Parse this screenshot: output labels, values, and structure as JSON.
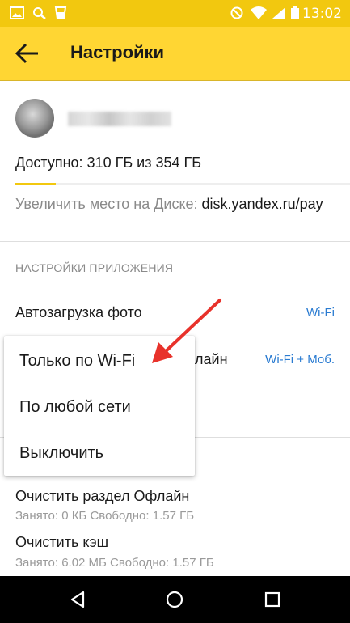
{
  "statusbar": {
    "time": "13:02",
    "icons": [
      "image-icon",
      "search-icon",
      "cup-icon",
      "dnd-icon",
      "wifi-icon",
      "signal-icon",
      "battery-icon"
    ]
  },
  "appbar": {
    "title": "Настройки",
    "back_icon": "back-arrow-icon"
  },
  "account": {
    "quota_text": "Доступно: 310 ГБ из 354 ГБ",
    "quota_used_fraction": 0.12
  },
  "increase": {
    "prefix": "Увеличить место на Диске: ",
    "link": "disk.yandex.ru/pay"
  },
  "app_settings": {
    "section_title": "НАСТРОЙКИ ПРИЛОЖЕНИЯ",
    "autoupload_label": "Автозагрузка фото",
    "autoupload_value": "Wi-Fi",
    "offline_label_visible": "лайн",
    "offline_value": "Wi-Fi + Моб."
  },
  "cleanup": {
    "offline_title": "Очистить раздел Офлайн",
    "offline_sub": "Занято: 0 КБ Свободно: 1.57 ГБ",
    "cache_title": "Очистить кэш",
    "cache_sub": "Занято: 6.02 МБ Свободно: 1.57 ГБ"
  },
  "popup": {
    "options": [
      "Только по Wi-Fi",
      "По любой сети",
      "Выключить"
    ]
  },
  "colors": {
    "statusbar": "#f2c80f",
    "appbar": "#ffd633",
    "link_blue": "#2a7bd1",
    "annotation_red": "#e8322b"
  },
  "navbar": {
    "buttons": [
      "back-triangle-icon",
      "home-circle-icon",
      "recents-square-icon"
    ]
  }
}
